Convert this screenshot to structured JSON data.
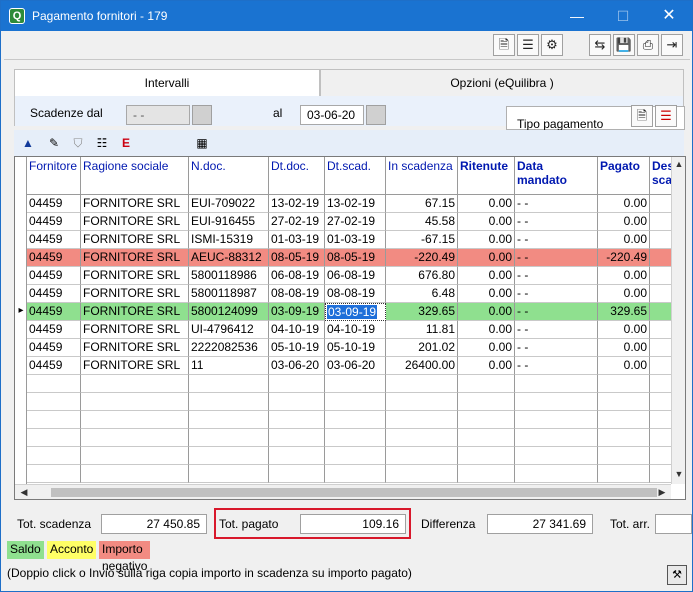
{
  "window": {
    "title": "Pagamento fornitori - 179",
    "minimize_glyph": "—",
    "maximize_glyph": "☐",
    "close_glyph": "✕",
    "app_icon_glyph": "Q"
  },
  "toolbar": {
    "buttons": [
      {
        "name": "document-icon",
        "glyph": "🗎"
      },
      {
        "name": "list-icon",
        "glyph": "☰"
      },
      {
        "name": "settings-icon",
        "glyph": "⚙"
      },
      {
        "name": "swap-icon",
        "glyph": "⇆"
      },
      {
        "name": "save-icon",
        "glyph": "💾"
      },
      {
        "name": "print-icon",
        "glyph": "⎙"
      },
      {
        "name": "exit-icon",
        "glyph": "⇥"
      }
    ]
  },
  "tabs": [
    {
      "label": "Intervalli",
      "active": true
    },
    {
      "label": "Opzioni (eQuilibra )",
      "active": false
    }
  ],
  "filters": {
    "scadenze_label": "Scadenze dal",
    "dal_value": "- -",
    "al_label": "al",
    "al_value": "03-06-20",
    "tipo_pagamento_label": "Tipo pagamento"
  },
  "grid_toolbar": {
    "buttons": [
      {
        "name": "sort-up-icon",
        "glyph": "▲"
      },
      {
        "name": "edit-filter-icon",
        "glyph": "✎"
      },
      {
        "name": "filter-icon",
        "glyph": "⛉"
      },
      {
        "name": "list-filter-icon",
        "glyph": "☷"
      },
      {
        "name": "export-icon",
        "glyph": "E"
      },
      {
        "name": "calculator-icon",
        "glyph": "▦"
      }
    ]
  },
  "grid": {
    "columns": [
      {
        "key": "fornitore",
        "label": "Fornitore",
        "bold": false
      },
      {
        "key": "ragione",
        "label": "Ragione sociale",
        "bold": false
      },
      {
        "key": "ndoc",
        "label": "N.doc.",
        "bold": false
      },
      {
        "key": "dtdoc",
        "label": "Dt.doc.",
        "bold": false
      },
      {
        "key": "dtscad",
        "label": "Dt.scad.",
        "bold": false
      },
      {
        "key": "inscad",
        "label": "In scadenza",
        "bold": false
      },
      {
        "key": "ritenute",
        "label": "Ritenute",
        "bold": true
      },
      {
        "key": "datamand",
        "label": "Data mandato",
        "bold": true
      },
      {
        "key": "pagato",
        "label": "Pagato",
        "bold": true
      },
      {
        "key": "desc",
        "label": "Des scad",
        "bold": true
      }
    ],
    "rows": [
      {
        "fornitore": "04459",
        "ragione": "FORNITORE SRL",
        "ndoc": "EUI-709022",
        "dtdoc": "13-02-19",
        "dtscad": "13-02-19",
        "inscad": "67.15",
        "ritenute": "0.00",
        "datamand": "- -",
        "pagato": "0.00",
        "status": "normal"
      },
      {
        "fornitore": "04459",
        "ragione": "FORNITORE SRL",
        "ndoc": "EUI-916455",
        "dtdoc": "27-02-19",
        "dtscad": "27-02-19",
        "inscad": "45.58",
        "ritenute": "0.00",
        "datamand": "- -",
        "pagato": "0.00",
        "status": "normal"
      },
      {
        "fornitore": "04459",
        "ragione": "FORNITORE SRL",
        "ndoc": "ISMI-15319",
        "dtdoc": "01-03-19",
        "dtscad": "01-03-19",
        "inscad": "-67.15",
        "ritenute": "0.00",
        "datamand": "- -",
        "pagato": "0.00",
        "status": "normal"
      },
      {
        "fornitore": "04459",
        "ragione": "FORNITORE SRL",
        "ndoc": "AEUC-88312",
        "dtdoc": "08-05-19",
        "dtscad": "08-05-19",
        "inscad": "-220.49",
        "ritenute": "0.00",
        "datamand": "- -",
        "pagato": "-220.49",
        "status": "negative"
      },
      {
        "fornitore": "04459",
        "ragione": "FORNITORE SRL",
        "ndoc": "5800118986",
        "dtdoc": "06-08-19",
        "dtscad": "06-08-19",
        "inscad": "676.80",
        "ritenute": "0.00",
        "datamand": "- -",
        "pagato": "0.00",
        "status": "normal"
      },
      {
        "fornitore": "04459",
        "ragione": "FORNITORE SRL",
        "ndoc": "5800118987",
        "dtdoc": "08-08-19",
        "dtscad": "08-08-19",
        "inscad": "6.48",
        "ritenute": "0.00",
        "datamand": "- -",
        "pagato": "0.00",
        "status": "normal"
      },
      {
        "fornitore": "04459",
        "ragione": "FORNITORE SRL",
        "ndoc": "5800124099",
        "dtdoc": "03-09-19",
        "dtscad": "03-09-19",
        "inscad": "329.65",
        "ritenute": "0.00",
        "datamand": "- -",
        "pagato": "329.65",
        "status": "saldo",
        "current": true
      },
      {
        "fornitore": "04459",
        "ragione": "FORNITORE SRL",
        "ndoc": "UI-4796412",
        "dtdoc": "04-10-19",
        "dtscad": "04-10-19",
        "inscad": "11.81",
        "ritenute": "0.00",
        "datamand": "- -",
        "pagato": "0.00",
        "status": "normal"
      },
      {
        "fornitore": "04459",
        "ragione": "FORNITORE SRL",
        "ndoc": "2222082536",
        "dtdoc": "05-10-19",
        "dtscad": "05-10-19",
        "inscad": "201.02",
        "ritenute": "0.00",
        "datamand": "- -",
        "pagato": "0.00",
        "status": "normal"
      },
      {
        "fornitore": "04459",
        "ragione": "FORNITORE SRL",
        "ndoc": "11",
        "dtdoc": "03-06-20",
        "dtscad": "03-06-20",
        "inscad": "26400.00",
        "ritenute": "0.00",
        "datamand": "- -",
        "pagato": "0.00",
        "status": "normal"
      }
    ],
    "current_row_marker": "▸"
  },
  "totals": {
    "scadenza_label": "Tot. scadenza",
    "scadenza_value": "27 450.85",
    "pagato_label": "Tot. pagato",
    "pagato_value": "109.16",
    "differenza_label": "Differenza",
    "differenza_value": "27 341.69",
    "arr_label": "Tot. arr.",
    "arr_value": ""
  },
  "legend": {
    "saldo": "Saldo",
    "acconto": "Acconto",
    "negativo": "Importo negativo"
  },
  "colors": {
    "saldo": "#8fe08f",
    "acconto": "#ffff66",
    "negativo": "#f28b82",
    "title_bar": "#1a73d1",
    "highlight": "#d8182b"
  },
  "hint": "(Doppio click o Invio sulla riga copia importo in scadenza su importo pagato)"
}
